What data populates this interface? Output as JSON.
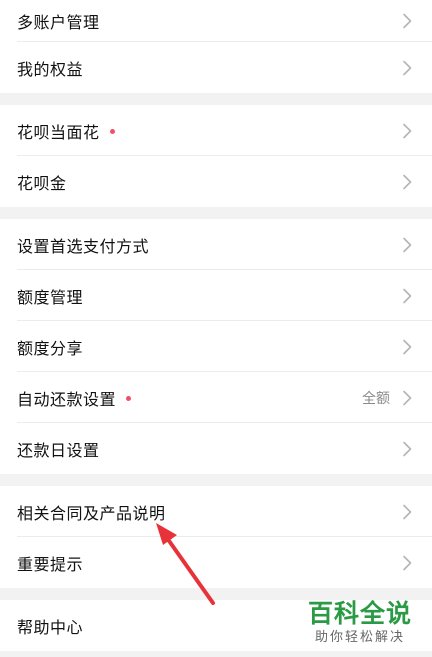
{
  "colors": {
    "page_background": "#f2f2f2",
    "notification_dot": "#f0506e",
    "annotation_arrow": "#e8323a",
    "watermark_title": "#2a9a45"
  },
  "groups": [
    {
      "items": [
        {
          "label": "多账户管理"
        },
        {
          "label": "我的权益"
        }
      ]
    },
    {
      "items": [
        {
          "label": "花呗当面花",
          "has_dot": true
        },
        {
          "label": "花呗金"
        }
      ]
    },
    {
      "items": [
        {
          "label": "设置首选支付方式"
        },
        {
          "label": "额度管理"
        },
        {
          "label": "额度分享"
        },
        {
          "label": "自动还款设置",
          "has_dot": true,
          "value": "全额"
        },
        {
          "label": "还款日设置"
        }
      ]
    },
    {
      "items": [
        {
          "label": "相关合同及产品说明"
        },
        {
          "label": "重要提示"
        }
      ]
    },
    {
      "items": [
        {
          "label": "帮助中心"
        }
      ]
    }
  ],
  "icons": {
    "row_chevron": "chevron-right-icon",
    "annotation": "red-arrow-icon"
  },
  "watermark": {
    "title": "百科全说",
    "subtitle": "助你轻松解决"
  }
}
